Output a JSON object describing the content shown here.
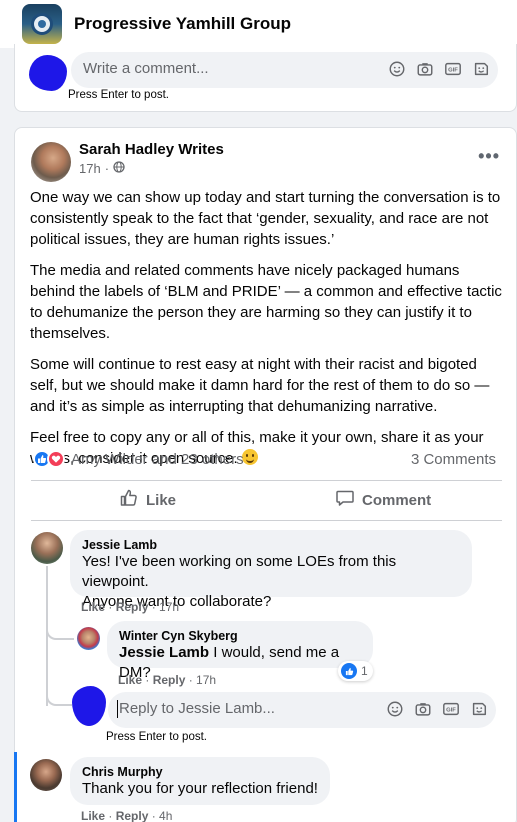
{
  "group": {
    "name": "Progressive Yamhill Group"
  },
  "composer_top": {
    "placeholder": "Write a comment...",
    "hint": "Press Enter to post."
  },
  "post": {
    "author": "Sarah Hadley Writes",
    "time": "17h",
    "paragraphs": [
      "One way we can show up today and start turning the conversation is to consistently speak to the fact that ‘gender, sexuality, and race are not political issues, they are human rights issues.’",
      "The media and related comments have nicely packaged humans behind the labels of ‘BLM and PRIDE’ — a common and effective tactic to dehumanize the person they are harming so they can justify it to themselves.",
      "Some will continue to rest easy at night with their racist and bigoted self, but we should make it damn hard for the rest of them to do so — and it’s as simple as interrupting that dehumanizing narrative.",
      "Feel free to copy any or all of this, make it your own, share it as your words, consider it open source."
    ],
    "reactions_text": "Amy Wilder and 23 others",
    "comments_count": "3 Comments",
    "like_label": "Like",
    "comment_label": "Comment"
  },
  "comments": [
    {
      "name": "Jessie Lamb",
      "text_line1": "Yes! I've been working on some LOEs from this viewpoint.",
      "text_line2": "Anyone want to collaborate?",
      "like": "Like",
      "reply": "Reply",
      "time": "17h"
    },
    {
      "name": "Winter Cyn Skyberg",
      "mention": "Jessie Lamb",
      "text": " I would, send me a DM?",
      "like": "Like",
      "reply": "Reply",
      "time": "17h",
      "reaction_count": "1"
    },
    {
      "name": "Chris Murphy",
      "text": "Thank you for your reflection friend!",
      "like": "Like",
      "reply": "Reply",
      "time": "4h"
    }
  ],
  "reply_composer": {
    "placeholder": "Reply to Jessie Lamb...",
    "hint": "Press Enter to post."
  },
  "icons": [
    "emoji-icon",
    "camera-icon",
    "gif-icon",
    "sticker-icon",
    "more-icon",
    "globe-icon",
    "like-icon",
    "comment-icon"
  ],
  "colors": {
    "accent": "#1877f2",
    "love": "#f33e58",
    "redaction": "#1e17e8"
  }
}
